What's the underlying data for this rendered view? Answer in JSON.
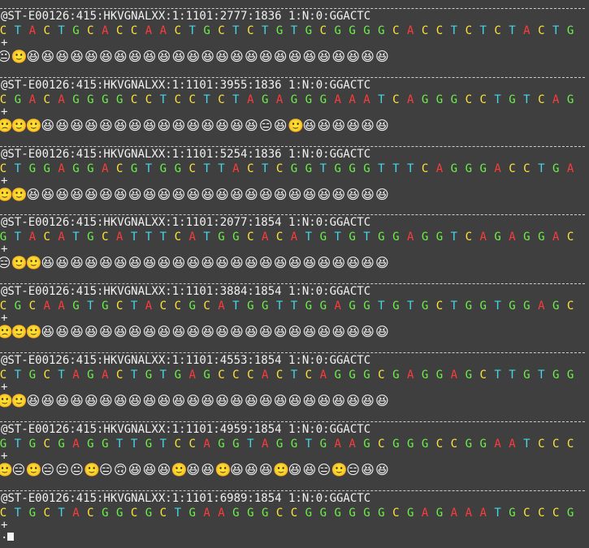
{
  "colors": {
    "background": "#3f3f3f",
    "text": "#f2f2f2",
    "A": "#ff3b3b",
    "C": "#ffe33a",
    "G": "#6df04a",
    "T": "#45d7ea"
  },
  "records": [
    {
      "header": "@ST-E00126:415:HKVGNALXX:1:1101:2777:1836 1:N:0:GGACTC",
      "sequence": "CTACTGCACCAACTGCTCTGTGCGGGGCACCTCTCTACTG",
      "separator": "+",
      "quality_icons": [
        "😐",
        "🙂",
        "😆",
        "😆",
        "😆",
        "😆",
        "😆",
        "😆",
        "😆",
        "😆",
        "😆",
        "😆",
        "😆",
        "😆",
        "😆",
        "😆",
        "😆",
        "😆",
        "😆",
        "😆",
        "😆",
        "😆",
        "😆",
        "😆",
        "😆",
        "😆",
        "😆"
      ]
    },
    {
      "header": "@ST-E00126:415:HKVGNALXX:1:1101:3955:1836 1:N:0:GGACTC",
      "sequence": "CGACAGGGGCCTCCTCTAGAGGGAAATCAGGGCCTGTCAG",
      "separator": "+",
      "quality_icons": [
        "🙁",
        "🙂",
        "🙂",
        "😆",
        "😆",
        "😆",
        "😆",
        "😆",
        "😆",
        "😆",
        "😆",
        "😆",
        "😆",
        "😆",
        "😆",
        "😆",
        "😆",
        "😆",
        "😑",
        "😆",
        "🙂",
        "😆",
        "😆",
        "😆",
        "😆",
        "😆",
        "😆"
      ]
    },
    {
      "header": "@ST-E00126:415:HKVGNALXX:1:1101:5254:1836 1:N:0:GGACTC",
      "sequence": "CTGGAGGACGTGGCTTACTCGGTGGGTTTCAGGGACCTGA",
      "separator": "+",
      "quality_icons": [
        "🙂",
        "🙂",
        "😆",
        "😆",
        "😆",
        "😆",
        "😆",
        "😆",
        "😆",
        "😆",
        "😆",
        "😆",
        "😆",
        "😆",
        "😆",
        "😆",
        "😆",
        "😆",
        "😆",
        "😆",
        "😆",
        "😆",
        "😆",
        "😆",
        "😆",
        "😆",
        "😆"
      ]
    },
    {
      "header": "@ST-E00126:415:HKVGNALXX:1:1101:2077:1854 1:N:0:GGACTC",
      "sequence": "GTACATGCATTTCATGGCACATGTGTGGAGGTCAGAGGAC",
      "separator": "+",
      "quality_icons": [
        "😑",
        "🙂",
        "🙂",
        "😆",
        "😆",
        "😆",
        "😆",
        "😆",
        "😆",
        "😆",
        "😆",
        "😆",
        "😆",
        "😆",
        "😆",
        "😆",
        "😆",
        "😆",
        "😆",
        "😆",
        "😆",
        "😆",
        "😆",
        "😆",
        "😆",
        "😆",
        "😆"
      ]
    },
    {
      "header": "@ST-E00126:415:HKVGNALXX:1:1101:3884:1854 1:N:0:GGACTC",
      "sequence": "CGCAAGTGCTACCGCATGGTTGGAGGTGTGCTGGTGGAGC",
      "separator": "+",
      "quality_icons": [
        "🙁",
        "🙂",
        "🙂",
        "😆",
        "😆",
        "😆",
        "😆",
        "😆",
        "😆",
        "😆",
        "😆",
        "😆",
        "😆",
        "😆",
        "😆",
        "😆",
        "😆",
        "😆",
        "😆",
        "😆",
        "😆",
        "😆",
        "😆",
        "😆",
        "😆",
        "😆",
        "😆"
      ]
    },
    {
      "header": "@ST-E00126:415:HKVGNALXX:1:1101:4553:1854 1:N:0:GGACTC",
      "sequence": "CTGCTAGACTGTGAGCCCACTCAGGGCGAGGAGCTTGTGG",
      "separator": "+",
      "quality_icons": [
        "🙂",
        "🙂",
        "😆",
        "😆",
        "😆",
        "😆",
        "😆",
        "😆",
        "😆",
        "😆",
        "😆",
        "😆",
        "😆",
        "😆",
        "😆",
        "😆",
        "😆",
        "😆",
        "😆",
        "😆",
        "😆",
        "😆",
        "😆",
        "😆",
        "😆",
        "😆",
        "😆"
      ]
    },
    {
      "header": "@ST-E00126:415:HKVGNALXX:1:1101:4959:1854 1:N:0:GGACTC",
      "sequence": "GTGCGAGGTTGTCCAGGTAGGTGAAGCGGGCCGGAATCCC",
      "separator": "+",
      "quality_icons": [
        "🙂",
        "😑",
        "🙂",
        "😑",
        "😐",
        "😐",
        "🙂",
        "😑",
        "🙃",
        "😆",
        "😆",
        "😆",
        "🙂",
        "😆",
        "😆",
        "🙂",
        "😆",
        "😆",
        "😆",
        "🙂",
        "😆",
        "😆",
        "😑",
        "🙂",
        "😑",
        "😆",
        "😆"
      ]
    },
    {
      "header": "@ST-E00126:415:HKVGNALXX:1:1101:6989:1854 1:N:0:GGACTC",
      "sequence": "CTGCTACGGCGCTGAAGGGCCGGGGGGCGAGAAATGCCCG",
      "separator": "+",
      "quality_icons": []
    }
  ],
  "prompt_symbol": "."
}
